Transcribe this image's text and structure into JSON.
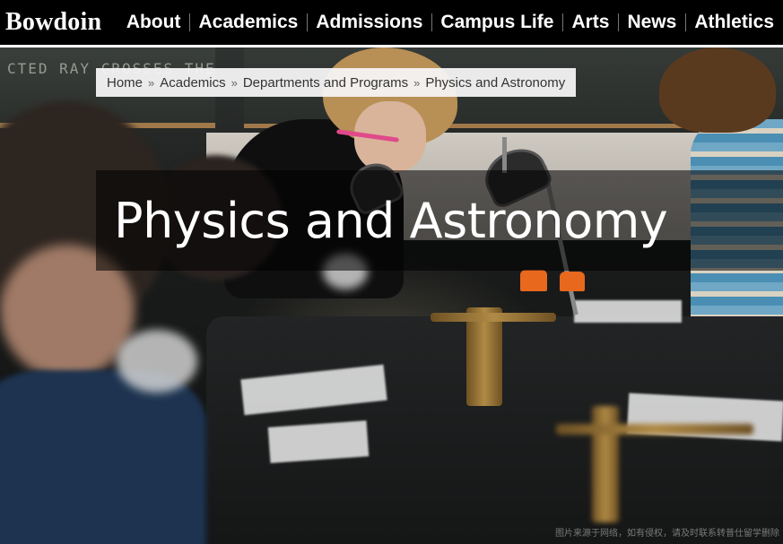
{
  "header": {
    "logo": "Bowdoin",
    "nav": [
      {
        "label": "About"
      },
      {
        "label": "Academics"
      },
      {
        "label": "Admissions"
      },
      {
        "label": "Campus Life"
      },
      {
        "label": "Arts"
      },
      {
        "label": "News"
      },
      {
        "label": "Athletics"
      }
    ]
  },
  "breadcrumb": {
    "items": [
      "Home",
      "Academics",
      "Departments and Programs",
      "Physics and Astronomy"
    ],
    "separator": "»"
  },
  "hero": {
    "title": "Physics and Astronomy",
    "chalkboard_text": "CTED RAY CROSSES THE",
    "watermark": "图片来源于网络，如有侵权，请及时联系转普仕留学删除"
  },
  "colors": {
    "topbar": "#000000",
    "breadcrumb_bg": "#f4f4f4",
    "title_band": "rgba(0,0,0,0.55)"
  }
}
